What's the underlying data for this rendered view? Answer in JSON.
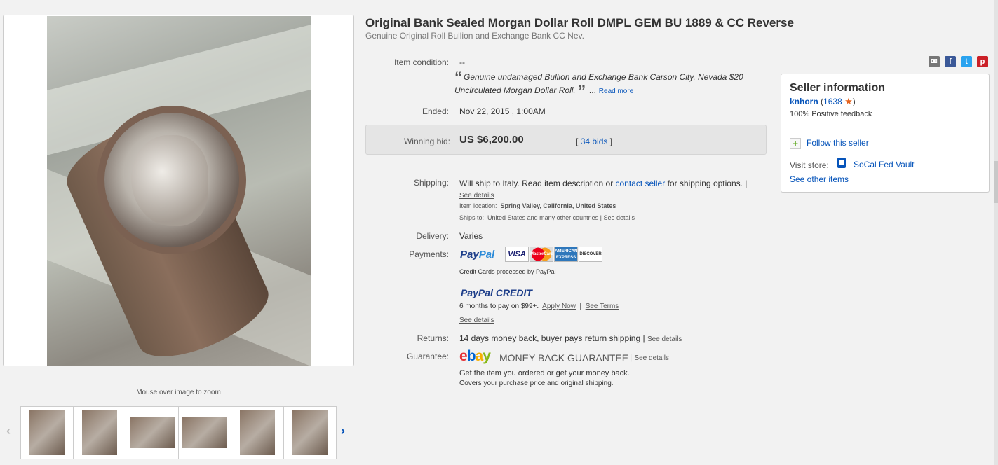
{
  "listing": {
    "title": "Original Bank Sealed Morgan Dollar Roll DMPL GEM BU 1889 & CC Reverse",
    "subtitle": "Genuine Original Roll Bullion and Exchange Bank CC Nev."
  },
  "gallery": {
    "zoom_hint": "Mouse over image to zoom",
    "thumbnail_count": 6,
    "prev_arrow": "‹",
    "next_arrow": "›"
  },
  "condition": {
    "label": "Item condition:",
    "value": "--",
    "quote_mark": "“",
    "quote": "Genuine undamaged Bullion and Exchange Bank Carson City, Nevada $20 Uncirculated Morgan Dollar Roll.",
    "quote_close": "”",
    "ellipsis": "...",
    "read_more": "Read more"
  },
  "ended": {
    "label": "Ended:",
    "value": "Nov 22, 2015 , 1:00AM"
  },
  "bid": {
    "label": "Winning bid:",
    "value": "US $6,200.00",
    "open": "[",
    "bids_link": "34 bids",
    "close": "]"
  },
  "shipping": {
    "label": "Shipping:",
    "text_before": "Will ship to Italy. Read item description or ",
    "contact_link": "contact seller",
    "text_after": " for shipping options. | ",
    "see_details": "See details",
    "location_label": "Item location:",
    "location_value": "Spring Valley, California, United States",
    "ships_to_label": "Ships to:",
    "ships_to_value": "United States and many other countries | ",
    "ships_see_details": "See details"
  },
  "delivery": {
    "label": "Delivery:",
    "value": "Varies"
  },
  "payments": {
    "label": "Payments:",
    "paypal_pay": "Pay",
    "paypal_pal": "Pal",
    "cards": {
      "visa": "VISA",
      "mastercard": "MasterCard",
      "amex": "AMERICAN EXPRESS",
      "discover": "DISCOVER"
    },
    "credit_cards_note": "Credit Cards processed by PayPal",
    "paypal_credit_pay": "PayPal",
    "paypal_credit_word": " CREDIT",
    "credit_terms_text": "6 months to pay on $99+.",
    "apply_now": "Apply Now",
    "see_terms": "See Terms",
    "see_details": "See details"
  },
  "returns": {
    "label": "Returns:",
    "value": "14 days money back, buyer pays return shipping | ",
    "see_details": "See details"
  },
  "guarantee": {
    "label": "Guarantee:",
    "logo": {
      "e": "e",
      "b": "b",
      "a": "a",
      "y": "y"
    },
    "title": "MONEY BACK GUARANTEE",
    "see_details": "See details",
    "line1": "Get the item you ordered or get your money back.",
    "line2": "Covers your purchase price and original shipping."
  },
  "share": {
    "email": "✉",
    "facebook": "f",
    "twitter": "t",
    "pinterest": "p"
  },
  "seller": {
    "title": "Seller information",
    "name": "knhorn",
    "score_open": " (",
    "score": "1638",
    "score_close": ")",
    "feedback": "100% Positive feedback",
    "follow": "Follow this seller",
    "follow_icon": "+",
    "store_label": "Visit store:",
    "store_name": "SoCal Fed Vault",
    "other_items": "See other items"
  },
  "colors": {
    "link": "#0654ba",
    "ebay_red": "#e53238",
    "ebay_blue": "#0064d2",
    "ebay_yellow": "#f5af02",
    "ebay_green": "#86b817"
  }
}
